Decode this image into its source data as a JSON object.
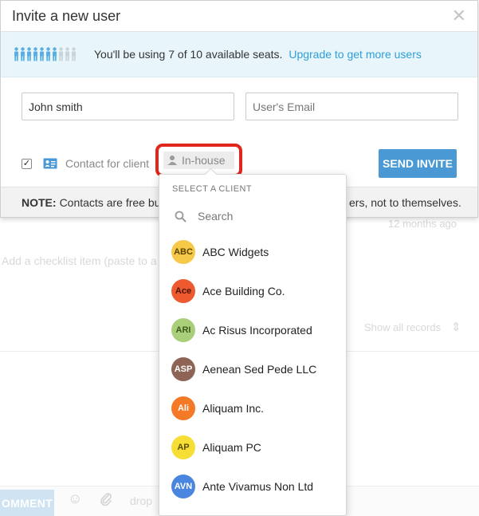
{
  "modal": {
    "title": "Invite a new user",
    "close_glyph": "✕"
  },
  "seats": {
    "used": 7,
    "total": 10,
    "message": "You'll be using 7 of 10 available seats.",
    "upgrade_link": "Upgrade to get more users",
    "used_color": "#5aaee0",
    "free_color": "#c8d4da"
  },
  "form": {
    "name_value": "John smith",
    "email_placeholder": "User's Email",
    "contact_checked": true,
    "check_glyph": "✓",
    "contact_label": "Contact for client",
    "client_selector_label": "In-house",
    "send_button": "SEND INVITE"
  },
  "note": {
    "prefix": "NOTE:",
    "text_start": "Contacts are free but",
    "text_end": "ers, not to themselves."
  },
  "client_dropdown": {
    "heading": "SELECT A CLIENT",
    "search_placeholder": "Search",
    "clients": [
      {
        "initials": "ABC",
        "name": "ABC Widgets",
        "color": "#f7c948",
        "text_color": "#5a4300"
      },
      {
        "initials": "Ace",
        "name": "Ace Building Co.",
        "color": "#ee5a2f",
        "text_color": "#4a1406"
      },
      {
        "initials": "ARI",
        "name": "Ac Risus Incorporated",
        "color": "#a9cf7a",
        "text_color": "#3b5a1a"
      },
      {
        "initials": "ASP",
        "name": "Aenean Sed Pede LLC",
        "color": "#8d6456",
        "text_color": "#ffffff"
      },
      {
        "initials": "Ali",
        "name": "Aliquam Inc.",
        "color": "#f47a28",
        "text_color": "#ffffff"
      },
      {
        "initials": "AP",
        "name": "Aliquam PC",
        "color": "#f6de34",
        "text_color": "#5a4e00"
      },
      {
        "initials": "AVN",
        "name": "Ante Vivamus Non Ltd",
        "color": "#4a86e0",
        "text_color": "#ffffff"
      }
    ]
  },
  "background": {
    "timestamp": "12 months ago",
    "checklist_placeholder": "Add a checklist item (paste to a",
    "show_records": "Show all records",
    "sort_glyph": "⇕",
    "comment_button": "OMMENT",
    "drop_text": "drop",
    "smiley_glyph": "☺"
  }
}
